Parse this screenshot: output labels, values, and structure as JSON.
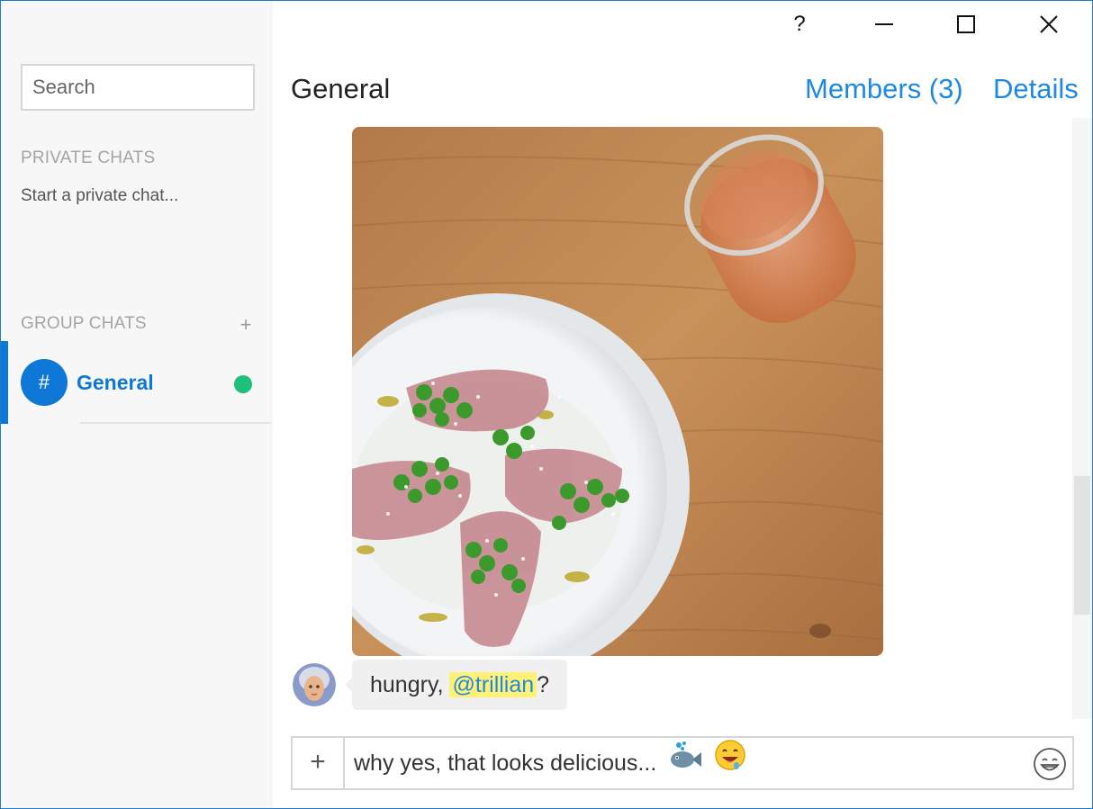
{
  "window": {
    "accent": "#1e7bd4"
  },
  "sidebar": {
    "search": {
      "placeholder": "Search",
      "value": ""
    },
    "private_chats": {
      "title": "PRIVATE CHATS",
      "hint": "Start a private chat..."
    },
    "group_chats": {
      "title": "GROUP CHATS",
      "add_label": "+",
      "items": [
        {
          "symbol": "#",
          "name": "General",
          "status": "online",
          "selected": true
        }
      ]
    }
  },
  "titlebar": {
    "help_label": "?"
  },
  "header": {
    "title": "General",
    "members_label": "Members (3)",
    "details_label": "Details"
  },
  "messages": [
    {
      "type": "image",
      "content": "food-photo"
    },
    {
      "type": "text",
      "text_before": "hungry, ",
      "mention": "@trillian",
      "text_after": "?"
    }
  ],
  "composer": {
    "attach_label": "+",
    "value": "why yes, that looks delicious...",
    "inline_emojis": [
      "fish-emoji",
      "drooling-face-emoji"
    ]
  },
  "colors": {
    "accent_blue": "#0f78d7",
    "link_blue": "#1e88e5",
    "online_green": "#1dbf7a",
    "mention_highlight": "#fff176",
    "sidebar_bg": "#f7f7f7"
  }
}
